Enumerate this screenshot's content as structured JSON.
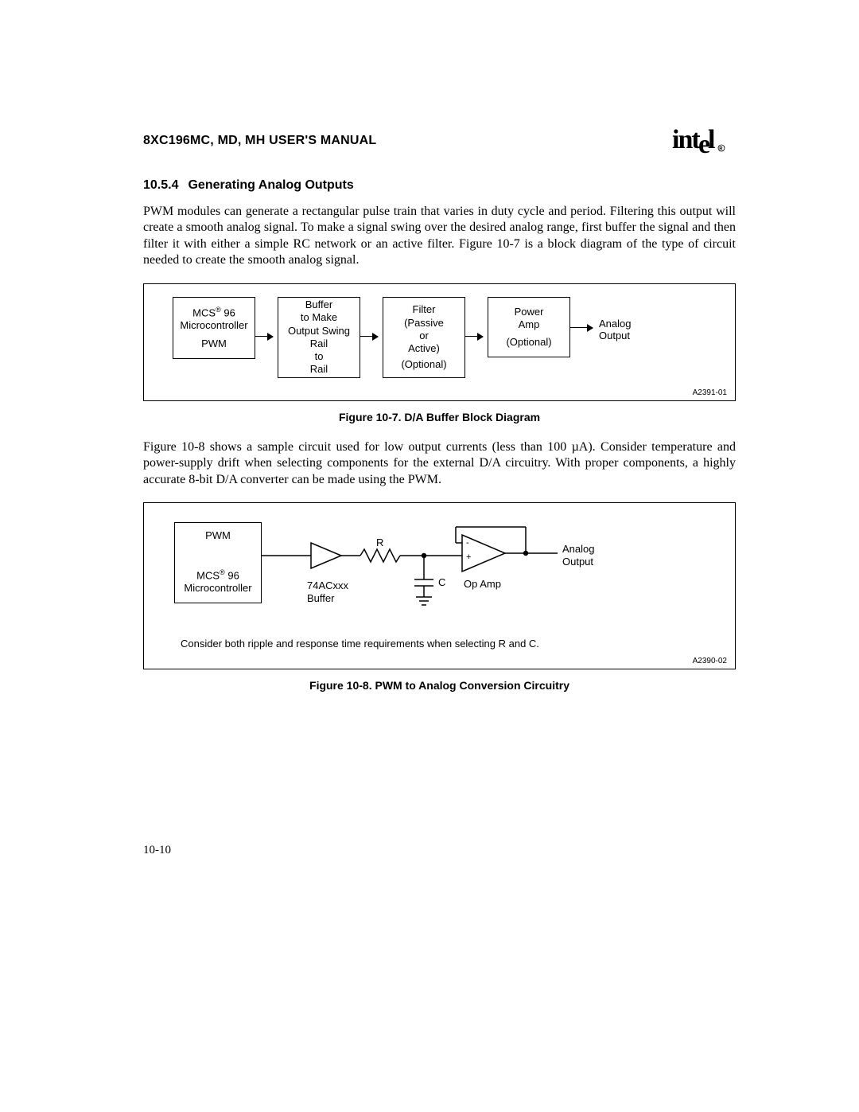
{
  "header": {
    "title": "8XC196MC, MD, MH USER'S MANUAL",
    "logo_name": "intel"
  },
  "section": {
    "number": "10.5.4",
    "title": "Generating Analog Outputs"
  },
  "para1": "PWM modules can generate a rectangular pulse train that varies in duty cycle and period. Filtering this output will create a smooth analog signal. To make a signal swing over the desired analog range, first buffer the signal and then filter it with either a simple RC network or an active filter. Figure 10-7 is a block diagram of the type of circuit needed to create the smooth analog signal.",
  "figure1": {
    "block1_l1": "MCS",
    "block1_reg": "®",
    "block1_l1b": " 96",
    "block1_l2": "Microcontroller",
    "block1_l3": "PWM",
    "block2_l1": "Buffer",
    "block2_l2": "to Make",
    "block2_l3": "Output Swing",
    "block2_l4": "Rail",
    "block2_l5": "to",
    "block2_l6": "Rail",
    "block3_l1": "Filter",
    "block3_l2": "(Passive",
    "block3_l3": "or",
    "block3_l4": "Active)",
    "block3_l5": "(Optional)",
    "block4_l1": "Power",
    "block4_l2": "Amp",
    "block4_l3": "(Optional)",
    "out1": "Analog",
    "out2": "Output",
    "code": "A2391-01",
    "caption": "Figure 10-7.  D/A Buffer Block Diagram"
  },
  "para2": "Figure 10-8 shows a sample circuit used for low output currents (less than 100 µA). Consider temperature and power-supply drift when selecting components for the external D/A circuitry. With proper components, a highly accurate 8-bit D/A converter can be made using the PWM.",
  "figure2": {
    "box_l1": "PWM",
    "box_l2a": "MCS",
    "box_reg": "®",
    "box_l2b": " 96",
    "box_l3": "Microcontroller",
    "buffer_l1": "74ACxxx",
    "buffer_l2": "Buffer",
    "R": "R",
    "C": "C",
    "opamp": "Op Amp",
    "out1": "Analog",
    "out2": "Output",
    "note": "Consider both ripple and response time requirements when selecting R and C.",
    "code": "A2390-02",
    "caption": "Figure 10-8.  PWM to Analog Conversion Circuitry"
  },
  "page_number": "10-10"
}
